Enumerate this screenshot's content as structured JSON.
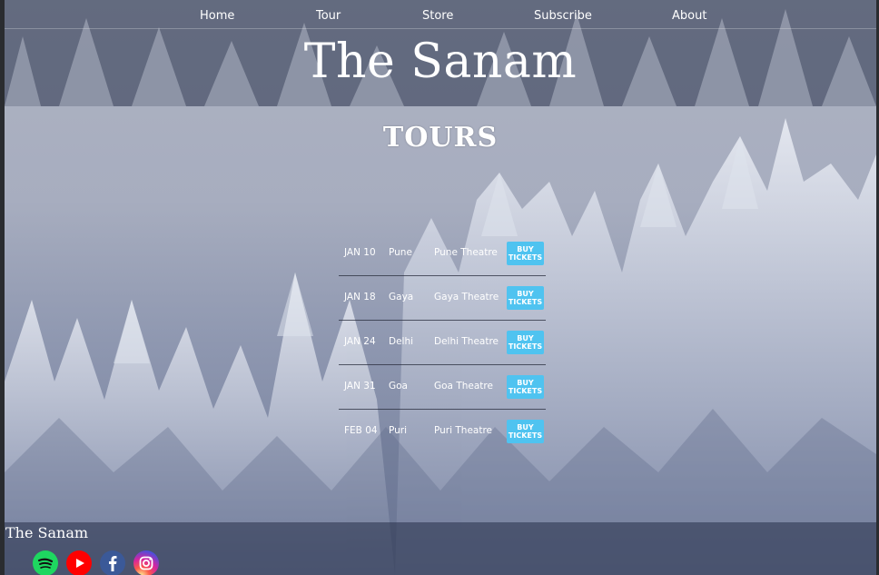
{
  "nav": {
    "items": [
      {
        "label": "Home"
      },
      {
        "label": "Tour"
      },
      {
        "label": "Store"
      },
      {
        "label": "Subscribe"
      },
      {
        "label": "About"
      }
    ]
  },
  "header": {
    "title": "The Sanam"
  },
  "main": {
    "heading": "TOURS",
    "tours": [
      {
        "date": "JAN 10",
        "city": "Pune",
        "venue": "Pune Theatre",
        "button": "BUY TICKETS"
      },
      {
        "date": "JAN 18",
        "city": "Gaya",
        "venue": "Gaya Theatre",
        "button": "BUY TICKETS"
      },
      {
        "date": "JAN 24",
        "city": "Delhi",
        "venue": "Delhi Theatre",
        "button": "BUY TICKETS"
      },
      {
        "date": "JAN 31",
        "city": "Goa",
        "venue": "Goa Theatre",
        "button": "BUY TICKETS"
      },
      {
        "date": "FEB 04",
        "city": "Puri",
        "venue": "Puri Theatre",
        "button": "BUY TICKETS"
      }
    ]
  },
  "footer": {
    "title": "The Sanam",
    "social": [
      {
        "icon": "spotify-icon",
        "color": "#1ed760"
      },
      {
        "icon": "youtube-icon",
        "color": "#ff0000"
      },
      {
        "icon": "facebook-icon",
        "color": "#3b5998"
      },
      {
        "icon": "instagram-icon",
        "color": "#d6249f"
      }
    ]
  },
  "colors": {
    "button": "#4fc3f0",
    "overlay": "#263048"
  }
}
